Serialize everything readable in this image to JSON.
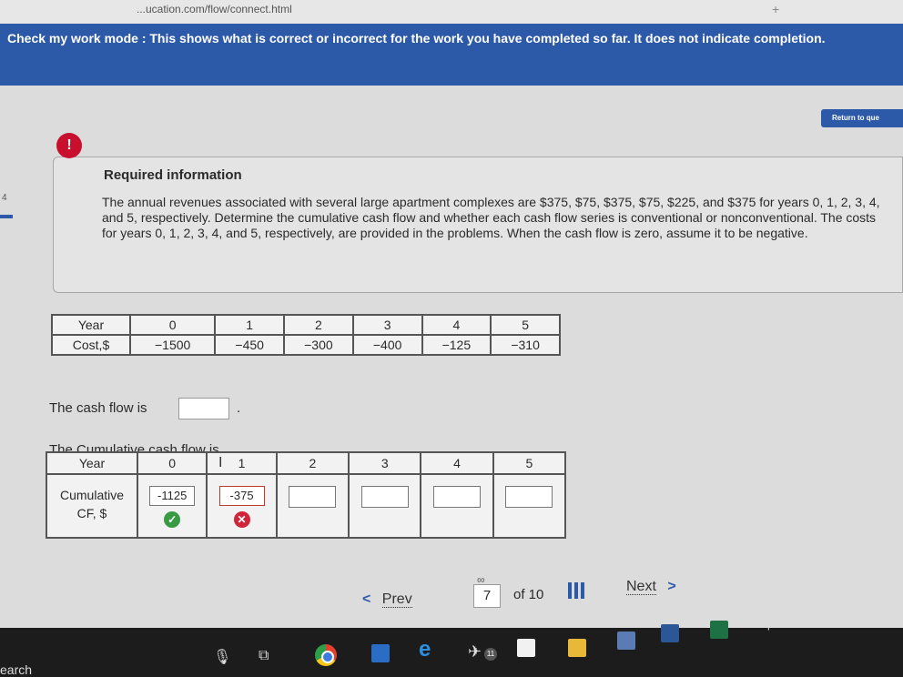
{
  "browser": {
    "url": "...ucation.com/flow/connect.html",
    "new_tab": "+"
  },
  "banner": {
    "text": "Check my work mode : This shows what is correct or incorrect for the work you have completed so far. It does not indicate completion."
  },
  "return_button": "Return to que",
  "left_nav_number": "4",
  "info": {
    "icon": "!",
    "title": "Required information",
    "body": "The annual revenues associated with several large apartment complexes are $375, $75, $375, $75, $225, and $375 for years 0, 1, 2, 3, 4, and 5, respectively. Determine the cumulative cash flow and whether each cash flow series is conventional or nonconventional. The costs for years 0, 1, 2, 3, 4, and 5, respectively, are provided in the problems. When the cash flow is zero, assume it to be negative."
  },
  "cost_table": {
    "header": "Year",
    "row_label": "Cost,$",
    "years": [
      "0",
      "1",
      "2",
      "3",
      "4",
      "5"
    ],
    "costs": [
      "−1500",
      "−450",
      "−300",
      "−400",
      "−125",
      "−310"
    ]
  },
  "cash_flow_question": {
    "label": "The cash flow is",
    "value": "",
    "suffix": "."
  },
  "cumulative": {
    "label": "The Cumulative cash flow is",
    "header": "Year",
    "row_label_1": "Cumulative",
    "row_label_2": "CF, $",
    "years": [
      "0",
      "1",
      "2",
      "3",
      "4",
      "5"
    ],
    "values": [
      "-1125",
      "-375",
      "",
      "",
      "",
      ""
    ],
    "status": [
      "correct",
      "incorrect"
    ]
  },
  "pagination": {
    "prev": "Prev",
    "current": "7",
    "of": "of 10",
    "next": "Next"
  },
  "taskbar": {
    "search": "earch",
    "badge": "11"
  }
}
